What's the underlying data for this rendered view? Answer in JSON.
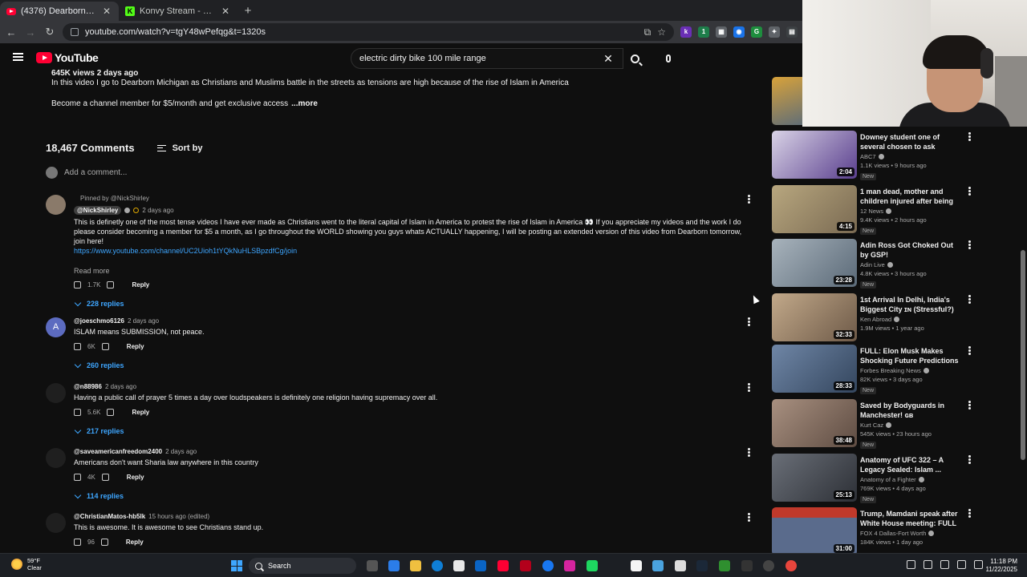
{
  "browser": {
    "tabs": [
      {
        "title": "(4376) Dearborn Michigan Has",
        "active": true
      },
      {
        "title": "Konvy Stream - Watch Live on",
        "active": false
      }
    ],
    "url": "youtube.com/watch?v=tgY48wPefqg&t=1320s"
  },
  "header": {
    "logo": "YouTube",
    "search_query": "electric dirty bike 100 mile range"
  },
  "description": {
    "meta": "645K views  2 days ago",
    "text": "In this video I go to Dearborn Michigan as Christians and Muslims battle in the streets as tensions are high because of the rise of Islam in America",
    "member_text": "Become a channel member for $5/month and get exclusive access",
    "more_label": "...more"
  },
  "comments": {
    "count": "18,467 Comments",
    "sort_label": "Sort by",
    "add_placeholder": "Add a comment...",
    "items": [
      {
        "pinned": "Pinned by @NickShirley",
        "author": "@NickShirley",
        "time": "2 days ago",
        "text": "This is definetly one of the most tense videos I have ever made as Christians went to the literal capital of Islam in America to protest the rise of Islam in America 👀 If you appreciate my videos and the work I do please consider becoming a member for $5 a month, as I go throughout the WORLD showing you guys whats ACTUALLY happening, I will be posting an extended version of this video from Dearborn tomorrow, join here!",
        "link": "https://www.youtube.com/channel/UC2Uioh1tYQkNuHLSBpzdfCg/join",
        "read_more": "Read more",
        "likes": "1.7K",
        "reply": "Reply",
        "replies": "228 replies"
      },
      {
        "author": "@joeschmo6126",
        "time": "2 days ago",
        "text": "ISLAM means SUBMISSION, not peace.",
        "likes": "6K",
        "reply": "Reply",
        "replies": "260 replies",
        "avatar_letter": "A"
      },
      {
        "author": "@n88986",
        "time": "2 days ago",
        "text": "Having a public call of prayer 5 times a day over loudspeakers is definitely one religion having supremacy over all.",
        "likes": "5.6K",
        "reply": "Reply",
        "replies": "217 replies"
      },
      {
        "author": "@saveamericanfreedom2400",
        "time": "2 days ago",
        "text": "Americans don't want Sharia law anywhere in this country",
        "likes": "4K",
        "reply": "Reply",
        "replies": "114 replies"
      },
      {
        "author": "@ChristianMatos-hb5lk",
        "time": "15 hours ago (edited)",
        "text": "This is awesome. It is awesome to see Christians stand up.",
        "likes": "96",
        "reply": "Reply"
      }
    ]
  },
  "sidebar": {
    "videos": [
      {
        "title": "Downey student one of several chosen to ask questions of ...",
        "channel": "ABC7",
        "meta": "1.1K views • 9 hours ago",
        "badge": "New",
        "duration": "2:04",
        "thumb_color": "#5a3f8e"
      },
      {
        "title": "1 man dead, mother and children injured after being sh...",
        "channel": "12 News",
        "meta": "9.4K views • 2 hours ago",
        "badge": "New",
        "duration": "4:15",
        "thumb_color": "#7a6a52"
      },
      {
        "title": "Adin Ross Got Choked Out by GSP!",
        "channel": "Adin Live",
        "meta": "4.8K views • 3 hours ago",
        "badge": "New",
        "duration": "23:28",
        "thumb_color": "#5b6a78"
      },
      {
        "title": "1st Arrival In Delhi, India's Biggest City ɪɴ (Stressful?)",
        "channel": "Ken Abroad",
        "meta": "1.9M views • 1 year ago",
        "badge": "",
        "duration": "32:33",
        "thumb_color": "#6e5a48"
      },
      {
        "title": "FULL: Elon Musk Makes Shocking Future Predictions A...",
        "channel": "Forbes Breaking News",
        "meta": "82K views • 3 days ago",
        "badge": "New",
        "duration": "28:33",
        "thumb_color": "#34465e"
      },
      {
        "title": "Saved by Bodyguards in Manchester! ɢʙ",
        "channel": "Kurt Caz",
        "meta": "545K views • 23 hours ago",
        "badge": "New",
        "duration": "38:48",
        "thumb_color": "#5e4c42"
      },
      {
        "title": "Anatomy of UFC 322 – A Legacy Sealed: Islam ...",
        "channel": "Anatomy of a Fighter",
        "meta": "769K views • 4 days ago",
        "badge": "New",
        "duration": "25:13",
        "thumb_color": "#2d3036"
      },
      {
        "title": "Trump, Mamdani speak after White House meeting: FULL",
        "channel": "FOX 4 Dallas-Fort Worth",
        "meta": "184K views • 1 day ago",
        "badge": "New",
        "duration": "31:00",
        "thumb_color": "#8c2a2a"
      }
    ]
  },
  "taskbar": {
    "weather_temp": "59°F",
    "weather_cond": "Clear",
    "search_label": "Search",
    "time": "11:18 PM",
    "date": "11/22/2025"
  }
}
